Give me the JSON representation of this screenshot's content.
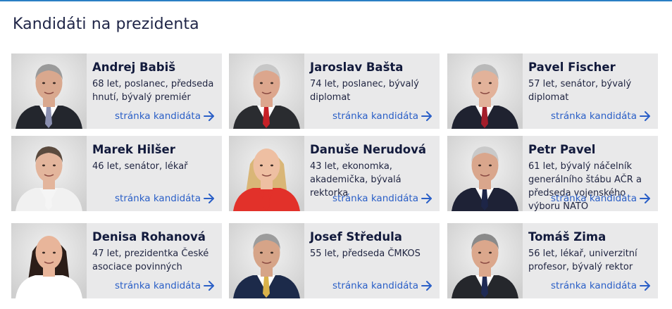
{
  "page_title": "Kandidáti na prezidenta",
  "link_label": "stránka kandidáta",
  "candidates": [
    {
      "name": "Andrej Babiš",
      "desc": "68 let, poslanec, předseda hnutí, bývalý premiér",
      "shirt": "#ffffff",
      "tie": "#8a8fb0",
      "hair": "#9a9a9a",
      "suit": "#23262d",
      "skin": "#d9a88e"
    },
    {
      "name": "Jaroslav Bašta",
      "desc": "74 let, poslanec, bývalý diplomat",
      "shirt": "#ffffff",
      "tie": "#c62026",
      "hair": "#c7c7c7",
      "suit": "#2a2c30",
      "skin": "#dca68d"
    },
    {
      "name": "Pavel Fischer",
      "desc": "57 let, senátor, bývalý diplomat",
      "shirt": "#ffffff",
      "tie": "#a31d2a",
      "hair": "#b9b9b9",
      "suit": "#1f2230",
      "skin": "#e2b29a"
    },
    {
      "name": "Marek Hilšer",
      "desc": "46 let, senátor, lékař",
      "shirt": "#f5f5f5",
      "tie": "#f5f5f5",
      "hair": "#5a4a3e",
      "suit": "#f1f1f1",
      "skin": "#e3b59c"
    },
    {
      "name": "Danuše Nerudová",
      "desc": "43 let, ekonomka, akademička, bývalá rektorka",
      "shirt": "#e2312a",
      "tie": "#e2312a",
      "hair": "#d9b677",
      "suit": "#e2312a",
      "skin": "#eebfa2"
    },
    {
      "name": "Petr Pavel",
      "desc": "61 let, bývalý náčelník generálního štábu AČR a předseda vojenského výboru NATO",
      "shirt": "#ffffff",
      "tie": "#1d2547",
      "hair": "#c9c9c9",
      "suit": "#1e2236",
      "skin": "#d9a68c"
    },
    {
      "name": "Denisa Rohanová",
      "desc": "47 let, prezidentka České asociace povinných",
      "shirt": "#ffffff",
      "tie": "#ffffff",
      "hair": "#2b1d18",
      "suit": "#ffffff",
      "skin": "#e8b59a"
    },
    {
      "name": "Josef Středula",
      "desc": "55 let, předseda ČMKOS",
      "shirt": "#ffffff",
      "tie": "#d9b24a",
      "hair": "#9c9c9c",
      "suit": "#1c2a4a",
      "skin": "#d6a488"
    },
    {
      "name": "Tomáš Zima",
      "desc": "56 let, lékař, univerzitní profesor, bývalý rektor",
      "shirt": "#ffffff",
      "tie": "#1e2a55",
      "hair": "#8a8a8a",
      "suit": "#25272c",
      "skin": "#dba78c"
    }
  ]
}
